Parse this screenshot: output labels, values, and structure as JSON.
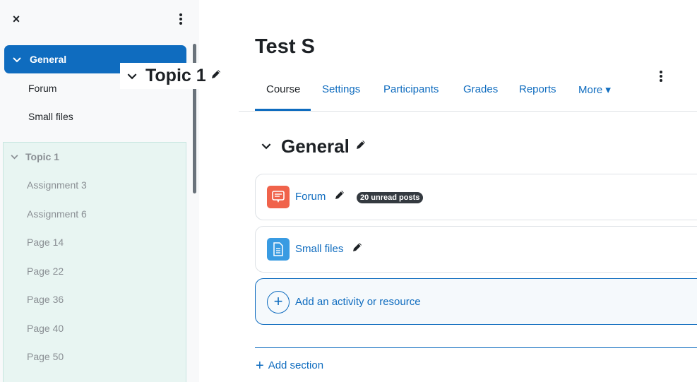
{
  "drawer": {
    "close_icon": "×",
    "general": {
      "label": "General"
    },
    "general_items": [
      "Forum",
      "Small files"
    ],
    "topic1": {
      "label": "Topic 1",
      "items": [
        "Assignment 3",
        "Assignment 6",
        "Page 14",
        "Page 22",
        "Page 36",
        "Page 40",
        "Page 50"
      ]
    }
  },
  "drag_ghost": {
    "title": "Topic 1"
  },
  "course": {
    "title": "Test S"
  },
  "tabs": [
    "Course",
    "Settings",
    "Participants",
    "Grades",
    "Reports",
    "More ▾"
  ],
  "section": {
    "title": "General"
  },
  "activities": [
    {
      "name": "Forum",
      "icon": "forum-icon",
      "color": "#f0634b",
      "badge": "20 unread posts"
    },
    {
      "name": "Small files",
      "icon": "file-icon",
      "color": "#399be2"
    }
  ],
  "add_activity": {
    "label": "Add an activity or resource"
  },
  "add_section": {
    "label": "Add section"
  },
  "colors": {
    "accent": "#0f6cbf",
    "drawer_bg": "#f8f9fa",
    "topic_bg": "#e8f5f2"
  }
}
